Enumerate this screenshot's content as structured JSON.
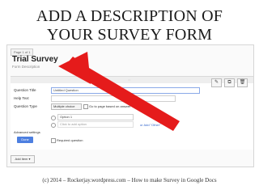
{
  "slide": {
    "title_line1": "ADD A DESCRIPTION OF",
    "title_line2": "YOUR SURVEY FORM",
    "footer": "(c) 2014 – Rockerjay.wordpress.com – How to make Survey in Google Docs"
  },
  "form": {
    "page_indicator": "Page 1 of 1",
    "title": "Trial Survey",
    "description_placeholder": "Form Description"
  },
  "editor": {
    "question_title_label": "Question Title",
    "question_title_value": "Untitled Question",
    "help_text_label": "Help Text",
    "question_type_label": "Question Type",
    "question_type_value": "Multiple choice",
    "go_to_page_label": "Go to page based on answer",
    "option1_value": "Option 1",
    "add_option_placeholder": "Click to add option",
    "add_other_text": "or Add \"Other\"",
    "advanced_settings": "Advanced settings",
    "done_label": "Done",
    "required_label": "Required question",
    "add_item_label": "Add item",
    "add_item_arrow": "▾",
    "edit_icon": "✎",
    "duplicate_icon": "⧉",
    "delete_icon": "🗑"
  }
}
